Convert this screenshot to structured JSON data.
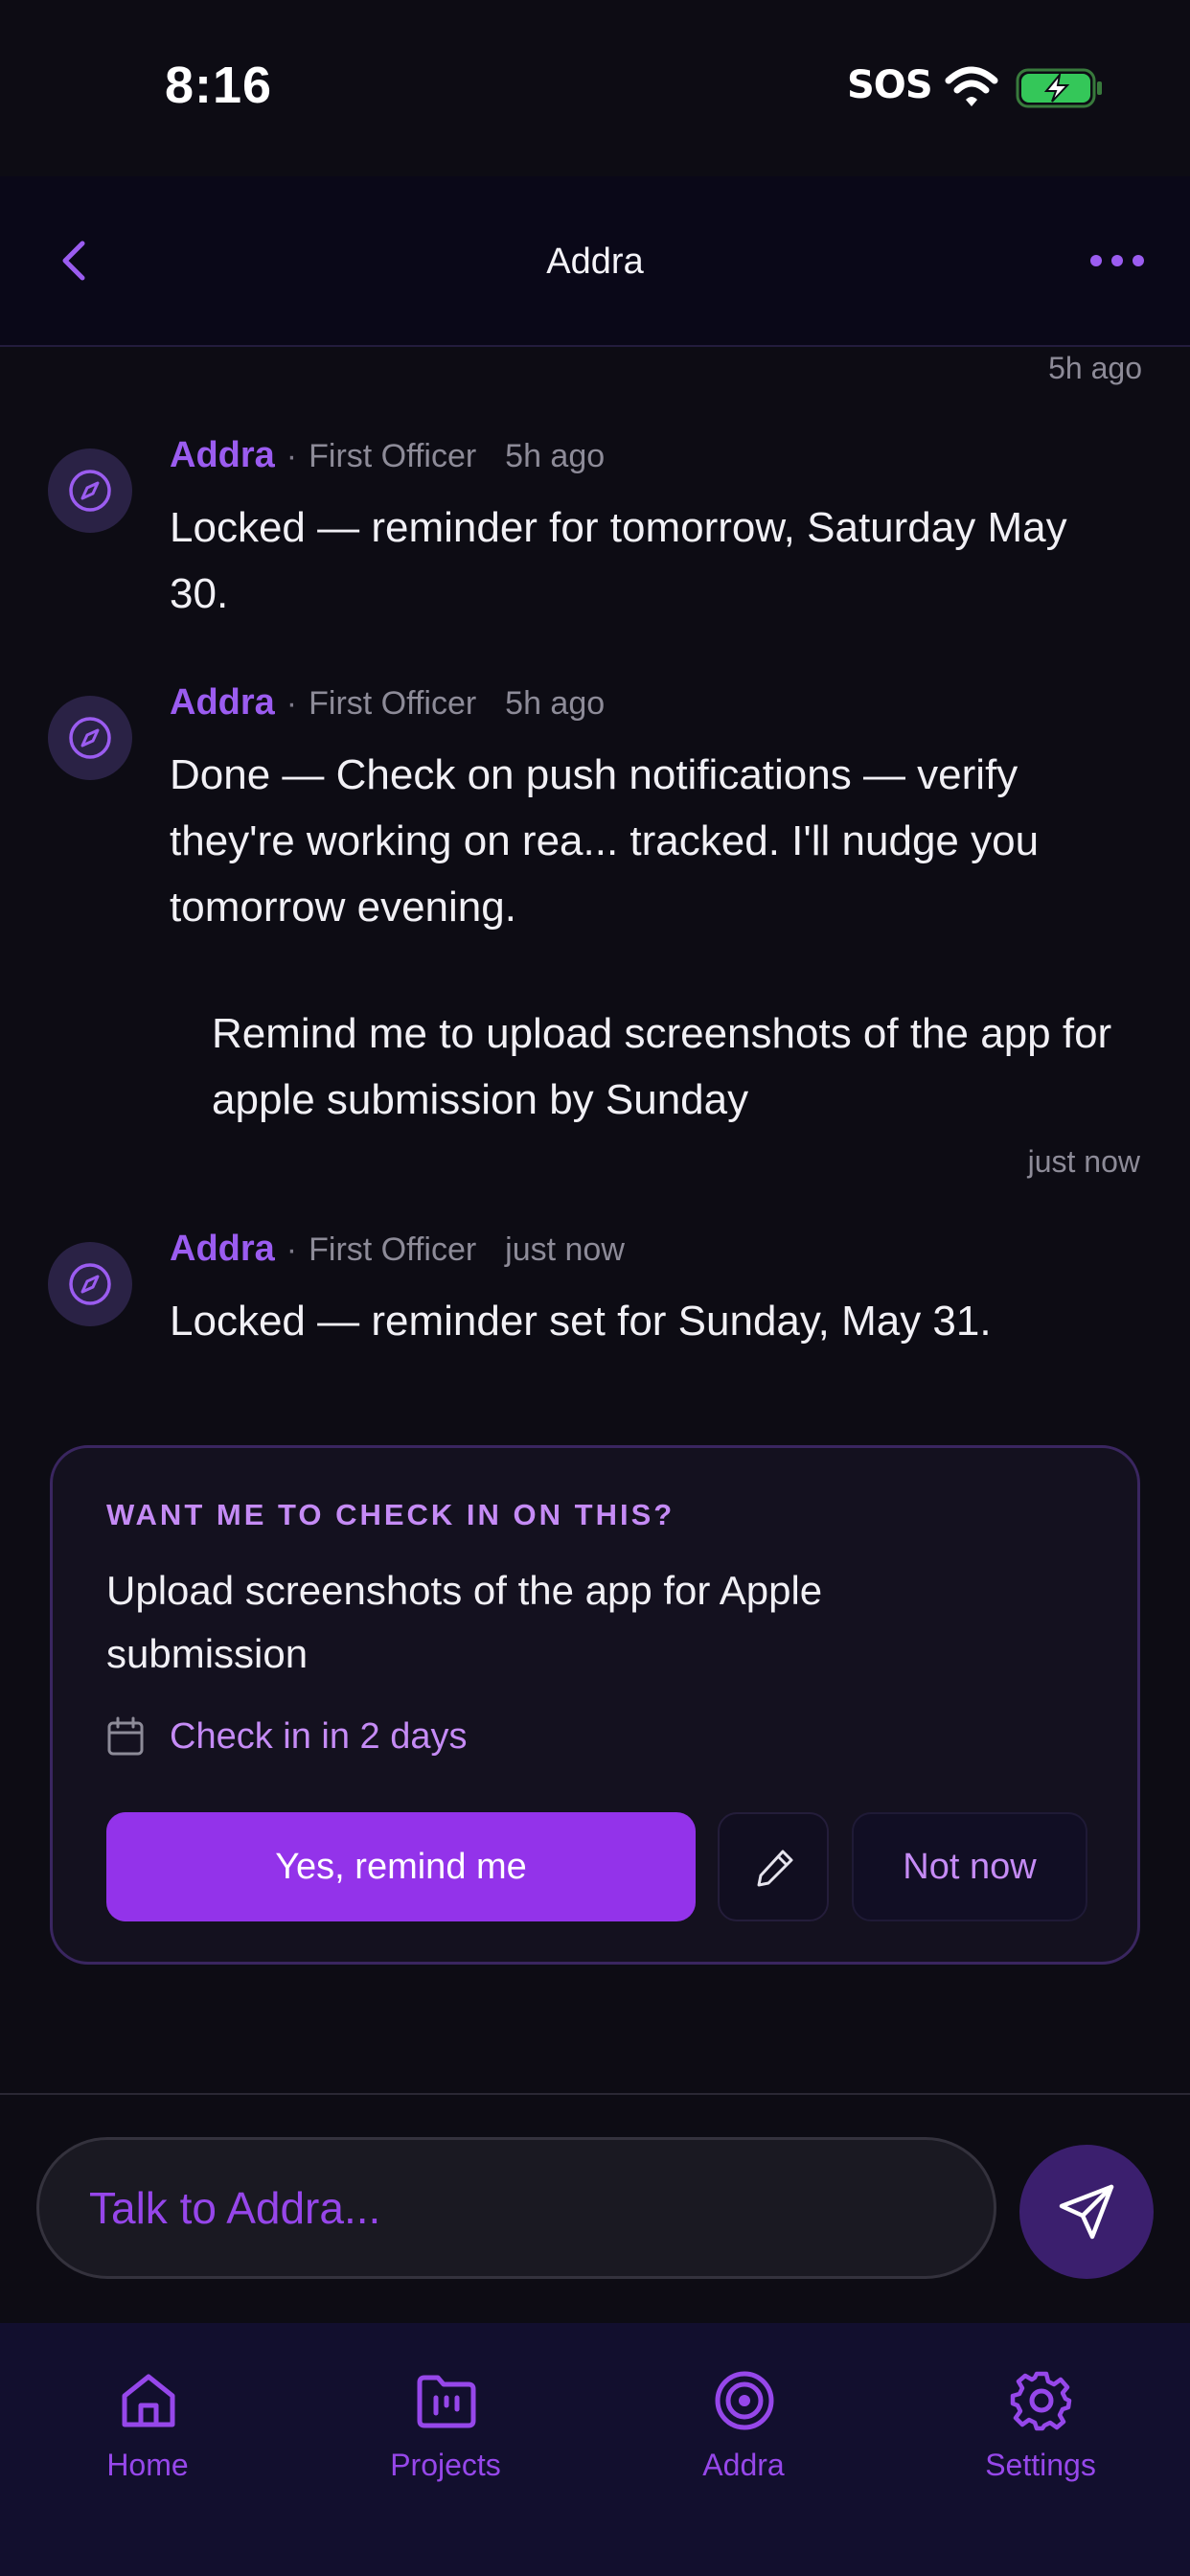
{
  "status_bar": {
    "time": "8:16",
    "carrier": "SOS"
  },
  "header": {
    "title": "Addra"
  },
  "chat": {
    "top_timestamp": "5h ago",
    "messages": [
      {
        "name": "Addra",
        "separator": "·",
        "role": "First Officer",
        "time": "5h ago",
        "text": "Locked — reminder for tomorrow, Saturday May 30."
      },
      {
        "name": "Addra",
        "separator": "·",
        "role": "First Officer",
        "time": "5h ago",
        "text": "Done — Check on push notifications — verify they're working on rea... tracked. I'll nudge you tomorrow evening."
      },
      {
        "name": "Addra",
        "separator": "·",
        "role": "First Officer",
        "time": "just now",
        "text": "Locked — reminder set for Sunday, May 31."
      }
    ],
    "user_message": {
      "text": "Remind me to upload screenshots of the app for apple submission by Sunday",
      "time": "just now"
    }
  },
  "checkin_card": {
    "eyebrow": "WANT ME TO CHECK IN ON THIS?",
    "text": "Upload screenshots of the app for Apple submission",
    "schedule": "Check in in 2 days",
    "yes_label": "Yes, remind me",
    "not_now_label": "Not now"
  },
  "composer": {
    "placeholder": "Talk to Addra..."
  },
  "tabbar": {
    "tabs": [
      {
        "label": "Home",
        "icon": "home-icon"
      },
      {
        "label": "Projects",
        "icon": "projects-icon"
      },
      {
        "label": "Addra",
        "icon": "target-icon"
      },
      {
        "label": "Settings",
        "icon": "gear-icon"
      }
    ]
  },
  "colors": {
    "background": "#0d0c14",
    "accent": "#9333ea",
    "accent_text": "#9b5cf0",
    "accent_light": "#c58bf5"
  }
}
